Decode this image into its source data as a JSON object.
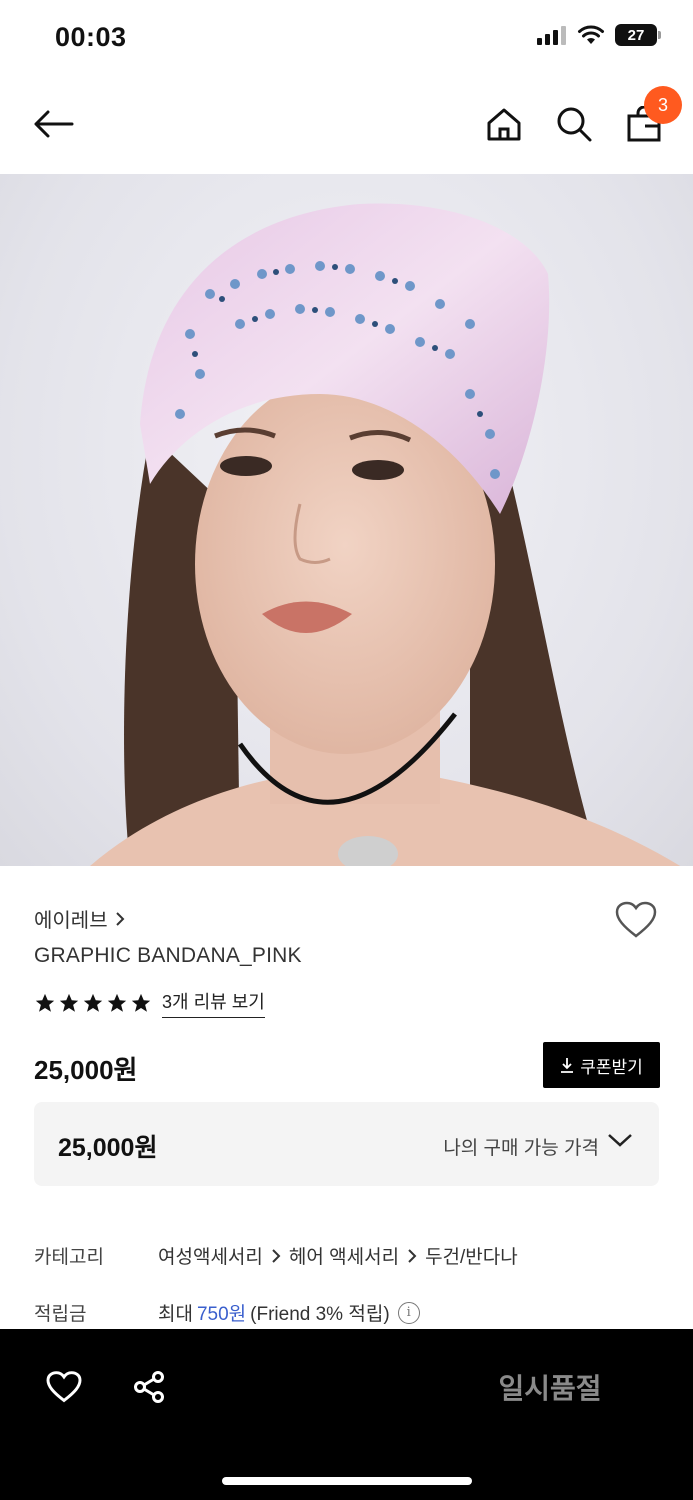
{
  "status": {
    "time": "00:03",
    "battery": "27"
  },
  "nav": {
    "cart_count": "3"
  },
  "product": {
    "brand": "에이레브",
    "name": "GRAPHIC BANDANA_PINK",
    "rating_stars": 5,
    "review_link": "3개 리뷰 보기",
    "price": "25,000원",
    "coupon_label": "쿠폰받기",
    "my_price": "25,000원",
    "my_price_label": "나의 구매 가능 가격"
  },
  "specs": {
    "category_key": "카테고리",
    "category_path": [
      "여성액세서리",
      "헤어 액세서리",
      "두건/반다나"
    ],
    "points_key": "적립금",
    "points_prefix": "최대",
    "points_value": "750원",
    "points_suffix": "(Friend 3% 적립)"
  },
  "bottom": {
    "soldout_label": "일시품절"
  },
  "colors": {
    "accent_badge": "#ff5a1f",
    "link_blue": "#3a5fcd",
    "bar_bg": "#000000"
  },
  "icons": [
    "back-arrow-icon",
    "home-icon",
    "search-icon",
    "shopping-bag-icon",
    "heart-icon",
    "star-icon",
    "download-icon",
    "chevron-down-icon",
    "info-icon",
    "share-icon"
  ]
}
